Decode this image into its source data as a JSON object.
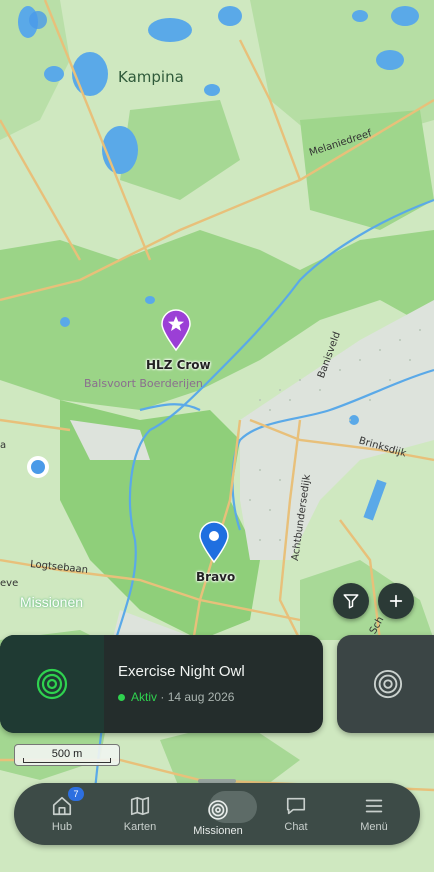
{
  "map": {
    "place_labels": {
      "kampina": "Kampina",
      "balsvoort": "Balsvoort Boerderijen",
      "melaniedreef": "Melaniedreef",
      "banisveld": "Banisveld",
      "brinksdijk": "Brinksdijk",
      "achtbundersedijk": "Achtbundersedijk",
      "logtsebaan": "Logtsebaan",
      "eve": "eve",
      "schaapsdijk": "Sch",
      "a": "a"
    },
    "markers": [
      {
        "id": "hlz-crow",
        "label": "HLZ Crow",
        "color": "#9b3fd6",
        "icon": "star-icon"
      },
      {
        "id": "bravo",
        "label": "Bravo",
        "color": "#1f6fe0",
        "icon": "dot-icon"
      }
    ],
    "missions_overlay_label": "Missionen",
    "scale_label": "500 m",
    "colors": {
      "land": "#cfe8c0",
      "forest": "#8fcf7a",
      "water": "#5aa9e8",
      "road": "#e8c07a",
      "heath": "#dde3dc"
    }
  },
  "buttons": {
    "filter_icon": "filter-icon",
    "add_icon": "plus-icon"
  },
  "mission_card": {
    "title": "Exercise Night Owl",
    "status": "Aktiv",
    "separator": " · ",
    "date": "14 aug 2026",
    "icon": "target-icon",
    "status_color": "#2fd24f"
  },
  "nav": {
    "items": [
      {
        "label": "Hub",
        "icon": "home-icon",
        "badge": "7"
      },
      {
        "label": "Karten",
        "icon": "map-icon"
      },
      {
        "label": "Missionen",
        "icon": "target-icon",
        "active": true
      },
      {
        "label": "Chat",
        "icon": "chat-icon"
      },
      {
        "label": "Menü",
        "icon": "menu-icon"
      }
    ]
  }
}
